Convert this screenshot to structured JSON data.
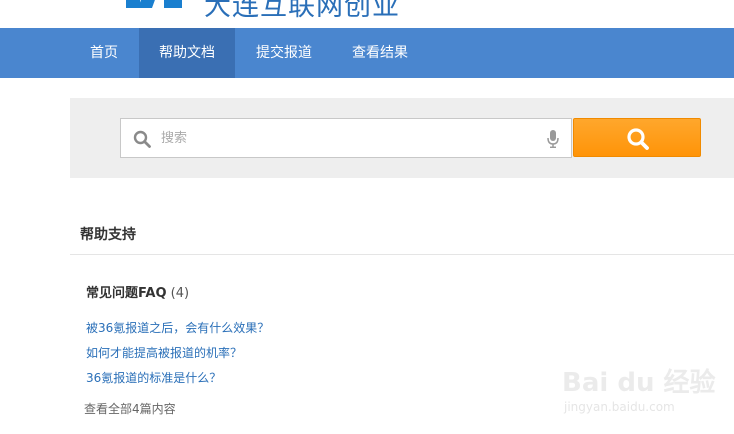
{
  "header": {
    "logo_text": "大连互联网创业"
  },
  "nav": {
    "items": [
      {
        "label": "首页"
      },
      {
        "label": "帮助文档"
      },
      {
        "label": "提交报道"
      },
      {
        "label": "查看结果"
      }
    ],
    "active_index": 1
  },
  "search": {
    "placeholder": "搜索"
  },
  "help": {
    "title": "帮助支持",
    "faq": {
      "title": "常见问题FAQ",
      "count": "(4)",
      "links": [
        "被36氪报道之后，会有什么效果？",
        "如何才能提高被报道的机率？",
        "36氪报道的标准是什么？"
      ],
      "view_all": "查看全部4篇内容"
    }
  },
  "watermark": {
    "brand": "Bai du 经验",
    "sub": "jingyan.baidu.com"
  },
  "colors": {
    "nav_bg": "#4a86cf",
    "nav_active_bg": "#3a6fb3",
    "search_button": "#ff9c16",
    "link": "#2a6fb8",
    "panel_bg": "#eeeeee"
  }
}
